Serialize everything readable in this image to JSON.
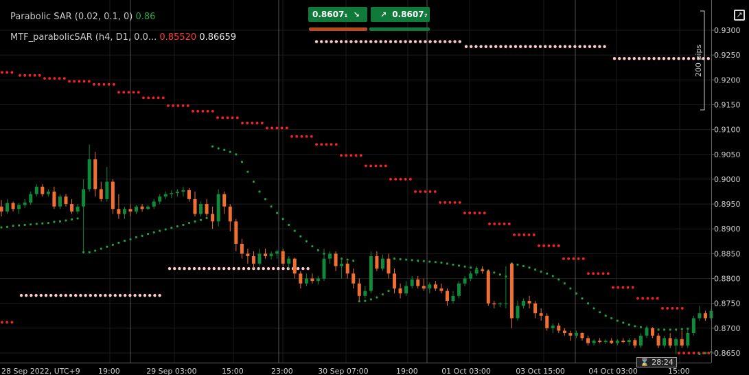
{
  "indicators": {
    "psar": {
      "label": "Parabolic SAR (0.02, 0.1, 0)",
      "value": "0.86"
    },
    "mtf": {
      "label": "MTF_parabolicSAR (h4, D1, 0.0...",
      "value1": "0.85520",
      "value2": "0.86659"
    }
  },
  "trade": {
    "sell_price": "0.8607₁",
    "buy_price": "0.8607₇"
  },
  "range_label": "200 pips",
  "countdown": "28:24",
  "colors": {
    "bull": "#0f8a3a",
    "bear": "#f07033",
    "sar_red": "#ff2020",
    "sar_green": "#1aa33a",
    "sar_pink": "#ffc8c8",
    "sell_bar": "#b84a1e",
    "buy_bar": "#0f7a3a"
  },
  "chart_data": {
    "type": "candlestick",
    "ylim": [
      0.8635,
      0.9315
    ],
    "y_ticks": [
      "0.9300",
      "0.9250",
      "0.9200",
      "0.9150",
      "0.9100",
      "0.9050",
      "0.9000",
      "0.8950",
      "0.8900",
      "0.8850",
      "0.8800",
      "0.8750",
      "0.8700",
      "0.8650"
    ],
    "x_ticks": [
      "28 Sep 2022, UTC+9",
      "19:00",
      "29 Sep 03:00",
      "15:00",
      "23:00",
      "30 Sep 07:00",
      "19:00",
      "01 Oct 03:00",
      "03 Oct 15:00",
      "04 Oct 03:00",
      "15:00"
    ],
    "candles": [
      {
        "o": 0.8945,
        "h": 0.8958,
        "l": 0.8925,
        "c": 0.8935
      },
      {
        "o": 0.8935,
        "h": 0.896,
        "l": 0.893,
        "c": 0.8952
      },
      {
        "o": 0.8952,
        "h": 0.8955,
        "l": 0.8935,
        "c": 0.894
      },
      {
        "o": 0.894,
        "h": 0.8952,
        "l": 0.893,
        "c": 0.8948
      },
      {
        "o": 0.8948,
        "h": 0.896,
        "l": 0.8942,
        "c": 0.8953
      },
      {
        "o": 0.8953,
        "h": 0.8975,
        "l": 0.8948,
        "c": 0.897
      },
      {
        "o": 0.897,
        "h": 0.899,
        "l": 0.8965,
        "c": 0.8985
      },
      {
        "o": 0.8985,
        "h": 0.899,
        "l": 0.8965,
        "c": 0.897
      },
      {
        "o": 0.897,
        "h": 0.898,
        "l": 0.8965,
        "c": 0.8975
      },
      {
        "o": 0.8975,
        "h": 0.8985,
        "l": 0.894,
        "c": 0.8945
      },
      {
        "o": 0.8945,
        "h": 0.897,
        "l": 0.894,
        "c": 0.8965
      },
      {
        "o": 0.8965,
        "h": 0.897,
        "l": 0.8945,
        "c": 0.895
      },
      {
        "o": 0.895,
        "h": 0.896,
        "l": 0.893,
        "c": 0.8935
      },
      {
        "o": 0.8935,
        "h": 0.895,
        "l": 0.893,
        "c": 0.8945
      },
      {
        "o": 0.8945,
        "h": 0.9,
        "l": 0.8855,
        "c": 0.898
      },
      {
        "o": 0.898,
        "h": 0.907,
        "l": 0.8975,
        "c": 0.904
      },
      {
        "o": 0.904,
        "h": 0.9055,
        "l": 0.8965,
        "c": 0.898
      },
      {
        "o": 0.898,
        "h": 0.8995,
        "l": 0.8955,
        "c": 0.896
      },
      {
        "o": 0.896,
        "h": 0.9025,
        "l": 0.8955,
        "c": 0.8995
      },
      {
        "o": 0.8995,
        "h": 0.9,
        "l": 0.893,
        "c": 0.894
      },
      {
        "o": 0.894,
        "h": 0.897,
        "l": 0.892,
        "c": 0.893
      },
      {
        "o": 0.893,
        "h": 0.8945,
        "l": 0.892,
        "c": 0.894
      },
      {
        "o": 0.894,
        "h": 0.895,
        "l": 0.8925,
        "c": 0.8935
      },
      {
        "o": 0.8935,
        "h": 0.8948,
        "l": 0.893,
        "c": 0.8945
      },
      {
        "o": 0.8945,
        "h": 0.895,
        "l": 0.8935,
        "c": 0.894
      },
      {
        "o": 0.894,
        "h": 0.8948,
        "l": 0.8938,
        "c": 0.8945
      },
      {
        "o": 0.8945,
        "h": 0.896,
        "l": 0.894,
        "c": 0.8955
      },
      {
        "o": 0.8955,
        "h": 0.897,
        "l": 0.895,
        "c": 0.8965
      },
      {
        "o": 0.8965,
        "h": 0.8975,
        "l": 0.896,
        "c": 0.897
      },
      {
        "o": 0.897,
        "h": 0.8978,
        "l": 0.8962,
        "c": 0.8972
      },
      {
        "o": 0.8972,
        "h": 0.898,
        "l": 0.8965,
        "c": 0.8975
      },
      {
        "o": 0.8975,
        "h": 0.8985,
        "l": 0.8965,
        "c": 0.8978
      },
      {
        "o": 0.8978,
        "h": 0.8982,
        "l": 0.8955,
        "c": 0.896
      },
      {
        "o": 0.896,
        "h": 0.8975,
        "l": 0.8925,
        "c": 0.893
      },
      {
        "o": 0.893,
        "h": 0.8955,
        "l": 0.8925,
        "c": 0.895
      },
      {
        "o": 0.895,
        "h": 0.896,
        "l": 0.8925,
        "c": 0.893
      },
      {
        "o": 0.893,
        "h": 0.8945,
        "l": 0.89,
        "c": 0.8915
      },
      {
        "o": 0.8915,
        "h": 0.898,
        "l": 0.8905,
        "c": 0.897
      },
      {
        "o": 0.897,
        "h": 0.8975,
        "l": 0.893,
        "c": 0.8945
      },
      {
        "o": 0.8945,
        "h": 0.895,
        "l": 0.8895,
        "c": 0.8915
      },
      {
        "o": 0.8915,
        "h": 0.892,
        "l": 0.8855,
        "c": 0.887
      },
      {
        "o": 0.887,
        "h": 0.888,
        "l": 0.884,
        "c": 0.885
      },
      {
        "o": 0.885,
        "h": 0.886,
        "l": 0.883,
        "c": 0.8845
      },
      {
        "o": 0.8845,
        "h": 0.8855,
        "l": 0.882,
        "c": 0.883
      },
      {
        "o": 0.883,
        "h": 0.886,
        "l": 0.8825,
        "c": 0.885
      },
      {
        "o": 0.885,
        "h": 0.886,
        "l": 0.884,
        "c": 0.8845
      },
      {
        "o": 0.8845,
        "h": 0.8855,
        "l": 0.8838,
        "c": 0.885
      },
      {
        "o": 0.885,
        "h": 0.8858,
        "l": 0.884,
        "c": 0.8855
      },
      {
        "o": 0.8855,
        "h": 0.886,
        "l": 0.8825,
        "c": 0.883
      },
      {
        "o": 0.883,
        "h": 0.8845,
        "l": 0.882,
        "c": 0.884
      },
      {
        "o": 0.884,
        "h": 0.8842,
        "l": 0.88,
        "c": 0.881
      },
      {
        "o": 0.881,
        "h": 0.8815,
        "l": 0.878,
        "c": 0.879
      },
      {
        "o": 0.879,
        "h": 0.881,
        "l": 0.8785,
        "c": 0.88
      },
      {
        "o": 0.88,
        "h": 0.881,
        "l": 0.879,
        "c": 0.8795
      },
      {
        "o": 0.8795,
        "h": 0.8805,
        "l": 0.8788,
        "c": 0.88
      },
      {
        "o": 0.88,
        "h": 0.886,
        "l": 0.8795,
        "c": 0.884
      },
      {
        "o": 0.884,
        "h": 0.8855,
        "l": 0.883,
        "c": 0.885
      },
      {
        "o": 0.885,
        "h": 0.8855,
        "l": 0.8815,
        "c": 0.8825
      },
      {
        "o": 0.8825,
        "h": 0.884,
        "l": 0.88,
        "c": 0.883
      },
      {
        "o": 0.883,
        "h": 0.8835,
        "l": 0.88,
        "c": 0.881
      },
      {
        "o": 0.881,
        "h": 0.882,
        "l": 0.878,
        "c": 0.879
      },
      {
        "o": 0.879,
        "h": 0.88,
        "l": 0.8755,
        "c": 0.8765
      },
      {
        "o": 0.8765,
        "h": 0.8785,
        "l": 0.876,
        "c": 0.8775
      },
      {
        "o": 0.8775,
        "h": 0.8855,
        "l": 0.877,
        "c": 0.8845
      },
      {
        "o": 0.8845,
        "h": 0.8855,
        "l": 0.8815,
        "c": 0.882
      },
      {
        "o": 0.882,
        "h": 0.8848,
        "l": 0.8815,
        "c": 0.884
      },
      {
        "o": 0.884,
        "h": 0.885,
        "l": 0.88,
        "c": 0.881
      },
      {
        "o": 0.881,
        "h": 0.882,
        "l": 0.877,
        "c": 0.878
      },
      {
        "o": 0.878,
        "h": 0.879,
        "l": 0.876,
        "c": 0.877
      },
      {
        "o": 0.877,
        "h": 0.8795,
        "l": 0.8765,
        "c": 0.8785
      },
      {
        "o": 0.8785,
        "h": 0.8805,
        "l": 0.878,
        "c": 0.8798
      },
      {
        "o": 0.8798,
        "h": 0.8805,
        "l": 0.878,
        "c": 0.8785
      },
      {
        "o": 0.8785,
        "h": 0.88,
        "l": 0.8775,
        "c": 0.878
      },
      {
        "o": 0.878,
        "h": 0.8792,
        "l": 0.877,
        "c": 0.8788
      },
      {
        "o": 0.8788,
        "h": 0.8795,
        "l": 0.8775,
        "c": 0.878
      },
      {
        "o": 0.878,
        "h": 0.879,
        "l": 0.877,
        "c": 0.8775
      },
      {
        "o": 0.8775,
        "h": 0.878,
        "l": 0.8745,
        "c": 0.8755
      },
      {
        "o": 0.8755,
        "h": 0.8775,
        "l": 0.875,
        "c": 0.8765
      },
      {
        "o": 0.8765,
        "h": 0.8795,
        "l": 0.876,
        "c": 0.879
      },
      {
        "o": 0.879,
        "h": 0.8805,
        "l": 0.8785,
        "c": 0.88
      },
      {
        "o": 0.88,
        "h": 0.8815,
        "l": 0.8795,
        "c": 0.881
      },
      {
        "o": 0.881,
        "h": 0.8825,
        "l": 0.8805,
        "c": 0.8818
      },
      {
        "o": 0.8818,
        "h": 0.8825,
        "l": 0.881,
        "c": 0.8815
      },
      {
        "o": 0.8815,
        "h": 0.8818,
        "l": 0.8745,
        "c": 0.875
      },
      {
        "o": 0.875,
        "h": 0.8755,
        "l": 0.874,
        "c": 0.8748
      },
      {
        "o": 0.8748,
        "h": 0.8752,
        "l": 0.8742,
        "c": 0.875
      },
      {
        "o": 0.875,
        "h": 0.8825,
        "l": 0.874,
        "c": 0.875
      },
      {
        "o": 0.883,
        "h": 0.8832,
        "l": 0.87,
        "c": 0.872
      },
      {
        "o": 0.872,
        "h": 0.8755,
        "l": 0.8715,
        "c": 0.8745
      },
      {
        "o": 0.8745,
        "h": 0.876,
        "l": 0.874,
        "c": 0.8755
      },
      {
        "o": 0.8755,
        "h": 0.8765,
        "l": 0.874,
        "c": 0.875
      },
      {
        "o": 0.875,
        "h": 0.8755,
        "l": 0.872,
        "c": 0.873
      },
      {
        "o": 0.873,
        "h": 0.874,
        "l": 0.8715,
        "c": 0.8725
      },
      {
        "o": 0.8725,
        "h": 0.873,
        "l": 0.8695,
        "c": 0.87
      },
      {
        "o": 0.87,
        "h": 0.871,
        "l": 0.869,
        "c": 0.8705
      },
      {
        "o": 0.8705,
        "h": 0.871,
        "l": 0.869,
        "c": 0.8695
      },
      {
        "o": 0.8695,
        "h": 0.87,
        "l": 0.8685,
        "c": 0.869
      },
      {
        "o": 0.869,
        "h": 0.8695,
        "l": 0.8675,
        "c": 0.8685
      },
      {
        "o": 0.8685,
        "h": 0.8695,
        "l": 0.868,
        "c": 0.869
      },
      {
        "o": 0.869,
        "h": 0.8692,
        "l": 0.8675,
        "c": 0.868
      },
      {
        "o": 0.868,
        "h": 0.8685,
        "l": 0.8665,
        "c": 0.867
      },
      {
        "o": 0.867,
        "h": 0.8678,
        "l": 0.8665,
        "c": 0.8675
      },
      {
        "o": 0.8675,
        "h": 0.868,
        "l": 0.867,
        "c": 0.8672
      },
      {
        "o": 0.8672,
        "h": 0.8678,
        "l": 0.8668,
        "c": 0.8675
      },
      {
        "o": 0.8675,
        "h": 0.868,
        "l": 0.8668,
        "c": 0.867
      },
      {
        "o": 0.867,
        "h": 0.8678,
        "l": 0.8665,
        "c": 0.8675
      },
      {
        "o": 0.8675,
        "h": 0.868,
        "l": 0.867,
        "c": 0.8672
      },
      {
        "o": 0.8672,
        "h": 0.868,
        "l": 0.8665,
        "c": 0.8676
      },
      {
        "o": 0.8676,
        "h": 0.868,
        "l": 0.866,
        "c": 0.8665
      },
      {
        "o": 0.8665,
        "h": 0.869,
        "l": 0.866,
        "c": 0.8685
      },
      {
        "o": 0.8685,
        "h": 0.8705,
        "l": 0.868,
        "c": 0.87
      },
      {
        "o": 0.87,
        "h": 0.8702,
        "l": 0.868,
        "c": 0.8685
      },
      {
        "o": 0.8685,
        "h": 0.869,
        "l": 0.866,
        "c": 0.8665
      },
      {
        "o": 0.8665,
        "h": 0.8685,
        "l": 0.866,
        "c": 0.868
      },
      {
        "o": 0.868,
        "h": 0.869,
        "l": 0.866,
        "c": 0.8665
      },
      {
        "o": 0.8665,
        "h": 0.8682,
        "l": 0.8648,
        "c": 0.8678
      },
      {
        "o": 0.8678,
        "h": 0.8695,
        "l": 0.866,
        "c": 0.8665
      },
      {
        "o": 0.8665,
        "h": 0.87,
        "l": 0.866,
        "c": 0.869
      },
      {
        "o": 0.869,
        "h": 0.8725,
        "l": 0.8685,
        "c": 0.872
      },
      {
        "o": 0.872,
        "h": 0.8745,
        "l": 0.8715,
        "c": 0.873
      },
      {
        "o": 0.873,
        "h": 0.8735,
        "l": 0.8715,
        "c": 0.872
      },
      {
        "o": 0.872,
        "h": 0.874,
        "l": 0.8715,
        "c": 0.8735
      }
    ],
    "psar": [
      0.8903,
      0.8904,
      0.8906,
      0.8907,
      0.8908,
      0.8909,
      0.891,
      0.8911,
      0.8912,
      0.8914,
      0.8915,
      0.8917,
      0.8919,
      0.8921,
      0.8853,
      0.8853,
      0.8856,
      0.886,
      0.8864,
      0.8868,
      0.8872,
      0.8876,
      0.8879,
      0.8883,
      0.8886,
      0.889,
      0.8893,
      0.8896,
      0.8899,
      0.8902,
      0.8905,
      0.8908,
      0.8912,
      0.8915,
      0.8918,
      0.8922,
      0.9066,
      0.9062,
      0.9059,
      0.9055,
      0.905,
      0.9035,
      0.9015,
      0.8995,
      0.8975,
      0.896,
      0.8945,
      0.8932,
      0.892,
      0.8908,
      0.8896,
      0.8885,
      0.8875,
      0.8865,
      0.8857,
      0.885,
      0.8845,
      0.8842,
      0.884,
      0.8838,
      0.8836,
      0.8754,
      0.8755,
      0.8758,
      0.8762,
      0.8768,
      0.8775,
      0.884,
      0.8839,
      0.8838,
      0.8837,
      0.8836,
      0.8835,
      0.8834,
      0.8833,
      0.8832,
      0.883,
      0.8828,
      0.8826,
      0.8824,
      0.8822,
      0.882,
      0.8818,
      0.8816,
      0.8812,
      0.8808,
      0.8804,
      0.883,
      0.8828,
      0.8825,
      0.8822,
      0.8818,
      0.8814,
      0.881,
      0.8805,
      0.8798,
      0.879,
      0.878,
      0.877,
      0.876,
      0.875,
      0.874,
      0.8732,
      0.8725,
      0.872,
      0.8715,
      0.8711,
      0.8707,
      0.8704,
      0.8702,
      0.87,
      0.8698,
      0.8697,
      0.8697,
      0.8697,
      0.8697,
      0.8698,
      0.8699,
      0.87,
      0.8648,
      0.865,
      0.8652,
      0.8655,
      0.8658
    ],
    "mtf_red": [
      {
        "x0": 0,
        "x1": 22,
        "y": 0.9215
      },
      {
        "x0": 26,
        "x1": 58,
        "y": 0.9209
      },
      {
        "x0": 62,
        "x1": 94,
        "y": 0.9203
      },
      {
        "x0": 98,
        "x1": 130,
        "y": 0.9197
      },
      {
        "x0": 134,
        "x1": 166,
        "y": 0.9191
      },
      {
        "x0": 170,
        "x1": 202,
        "y": 0.9175
      },
      {
        "x0": 206,
        "x1": 238,
        "y": 0.9164
      },
      {
        "x0": 242,
        "x1": 274,
        "y": 0.9148
      },
      {
        "x0": 278,
        "x1": 310,
        "y": 0.9137
      },
      {
        "x0": 314,
        "x1": 346,
        "y": 0.9124
      },
      {
        "x0": 350,
        "x1": 382,
        "y": 0.9113
      },
      {
        "x0": 386,
        "x1": 418,
        "y": 0.9103
      },
      {
        "x0": 422,
        "x1": 454,
        "y": 0.9086
      },
      {
        "x0": 458,
        "x1": 490,
        "y": 0.907
      },
      {
        "x0": 494,
        "x1": 526,
        "y": 0.9048
      },
      {
        "x0": 530,
        "x1": 562,
        "y": 0.9027
      },
      {
        "x0": 566,
        "x1": 598,
        "y": 0.9
      },
      {
        "x0": 602,
        "x1": 634,
        "y": 0.8975
      },
      {
        "x0": 638,
        "x1": 670,
        "y": 0.8953
      },
      {
        "x0": 674,
        "x1": 706,
        "y": 0.8932
      },
      {
        "x0": 710,
        "x1": 742,
        "y": 0.891
      },
      {
        "x0": 746,
        "x1": 778,
        "y": 0.8888
      },
      {
        "x0": 782,
        "x1": 814,
        "y": 0.8866
      },
      {
        "x0": 818,
        "x1": 850,
        "y": 0.884
      },
      {
        "x0": 854,
        "x1": 886,
        "y": 0.881
      },
      {
        "x0": 890,
        "x1": 922,
        "y": 0.8782
      },
      {
        "x0": 926,
        "x1": 958,
        "y": 0.876
      },
      {
        "x0": 962,
        "x1": 994,
        "y": 0.874
      },
      {
        "x0": 0,
        "x1": 22,
        "y": 0.8712
      },
      {
        "x0": 986,
        "x1": 1036,
        "y": 0.865
      }
    ],
    "mtf_pink": [
      {
        "x0": 28,
        "x1": 238,
        "y": 0.8766
      },
      {
        "x0": 244,
        "x1": 454,
        "y": 0.882
      },
      {
        "x0": 458,
        "x1": 670,
        "y": 0.9277
      },
      {
        "x0": 676,
        "x1": 886,
        "y": 0.9267
      },
      {
        "x0": 892,
        "x1": 1036,
        "y": 0.9243
      }
    ],
    "vlines_x": [
      190,
      406,
      622,
      838
    ]
  }
}
